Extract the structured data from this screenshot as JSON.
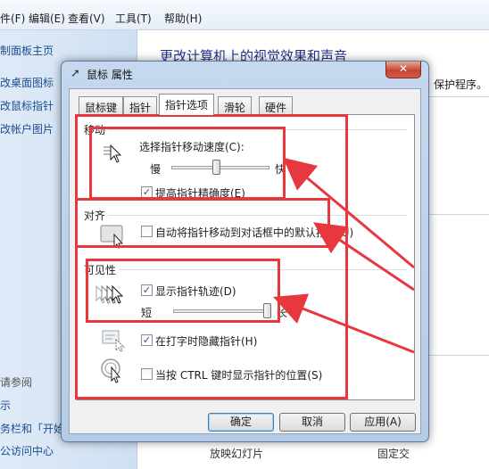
{
  "menu": {
    "items": [
      "件(F)",
      "编辑(E)",
      "查看(V)",
      "工具(T)",
      "帮助(H)"
    ]
  },
  "sidebar": {
    "links": [
      "制面板主页",
      "改桌面图标",
      "改鼠标指针",
      "改帐户图片"
    ],
    "see_also": "请参阅",
    "bottom_links": [
      "示",
      "务栏和「开始",
      "公访问中心"
    ]
  },
  "main": {
    "title": "更改计算机上的视觉效果和声音",
    "right_text": "保护程序。",
    "bottom_text_1": "放映幻灯片",
    "bottom_text_2": "固定交"
  },
  "dialog": {
    "title": "鼠标 属性",
    "close_glyph": "✕",
    "tabs": [
      "鼠标键",
      "指针",
      "指针选项",
      "滑轮",
      "硬件"
    ],
    "active_tab_index": 2,
    "motion": {
      "group_label": "移动",
      "speed_label": "选择指针移动速度(C):",
      "slow": "慢",
      "fast": "快",
      "speed_value_fraction": 0.45,
      "enhance_precision_label": "提高指针精确度(E)",
      "enhance_precision_checked": true
    },
    "snap_to": {
      "group_label": "对齐",
      "snap_label": "自动将指针移动到对话框中的默认按钮(U)",
      "snap_checked": false
    },
    "visibility": {
      "group_label": "可见性",
      "trails_label": "显示指针轨迹(D)",
      "trails_checked": true,
      "short": "短",
      "long": "长",
      "trail_length_fraction": 0.95,
      "hide_typing_label": "在打字时隐藏指针(H)",
      "hide_typing_checked": true,
      "show_location_label": "当按 CTRL 键时显示指针的位置(S)",
      "show_location_checked": false
    },
    "buttons": {
      "ok": "确定",
      "cancel": "取消",
      "apply": "应用(A)"
    }
  },
  "colors": {
    "annotation_red": "#e8383f",
    "title_blue": "#1e3287",
    "link_blue": "#1a4e8f"
  }
}
